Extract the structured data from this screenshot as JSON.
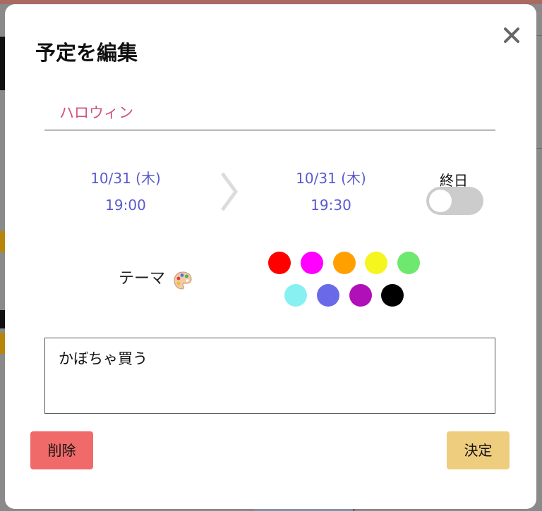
{
  "modal": {
    "title": "予定を編集",
    "event_title": "ハロウィン",
    "start": {
      "date": "10/31 (木)",
      "time": "19:00"
    },
    "end": {
      "date": "10/31 (木)",
      "time": "19:30"
    },
    "all_day": {
      "label": "終日",
      "enabled": false
    },
    "theme": {
      "label": "テーマ",
      "icon": "palette-icon",
      "colors": [
        "#ff0000",
        "#ff00ff",
        "#ffa000",
        "#f5f520",
        "#6ee86e",
        "#88f0f0",
        "#6a6ae8",
        "#b010b8",
        "#000000"
      ]
    },
    "memo": "かぼちゃ買う",
    "delete_label": "削除",
    "confirm_label": "決定",
    "close_icon": "close-icon"
  }
}
